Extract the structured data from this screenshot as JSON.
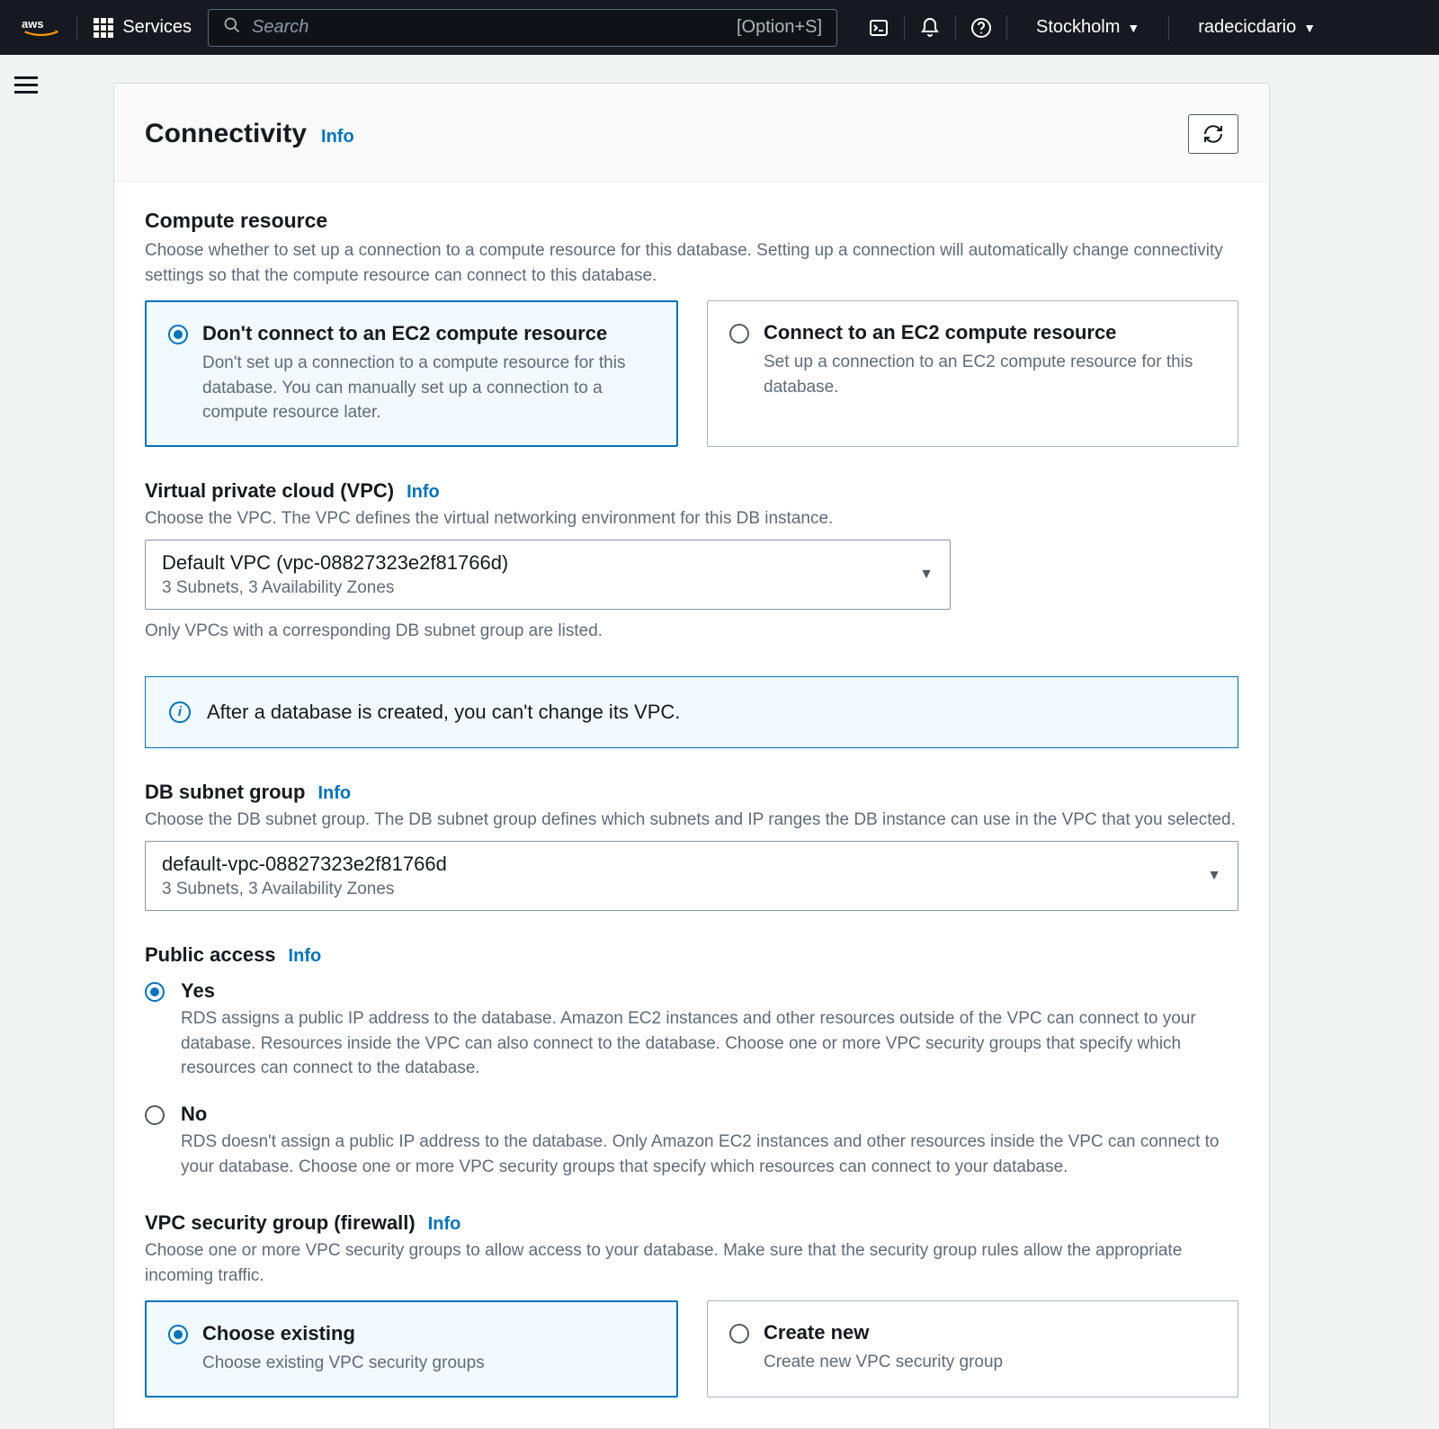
{
  "topbar": {
    "services": "Services",
    "search_placeholder": "Search",
    "kbd_hint": "[Option+S]",
    "region": "Stockholm",
    "user": "radecicdario"
  },
  "panel": {
    "title": "Connectivity",
    "info": "Info"
  },
  "compute": {
    "title": "Compute resource",
    "desc": "Choose whether to set up a connection to a compute resource for this database. Setting up a connection will automatically change connectivity settings so that the compute resource can connect to this database.",
    "opt_a_title": "Don't connect to an EC2 compute resource",
    "opt_a_desc": "Don't set up a connection to a compute resource for this database. You can manually set up a connection to a compute resource later.",
    "opt_b_title": "Connect to an EC2 compute resource",
    "opt_b_desc": "Set up a connection to an EC2 compute resource for this database."
  },
  "vpc": {
    "label": "Virtual private cloud (VPC)",
    "info": "Info",
    "desc": "Choose the VPC. The VPC defines the virtual networking environment for this DB instance.",
    "value": "Default VPC (vpc-08827323e2f81766d)",
    "sub": "3 Subnets, 3 Availability Zones",
    "helper": "Only VPCs with a corresponding DB subnet group are listed.",
    "banner": "After a database is created, you can't change its VPC."
  },
  "subnet": {
    "label": "DB subnet group",
    "info": "Info",
    "desc": "Choose the DB subnet group. The DB subnet group defines which subnets and IP ranges the DB instance can use in the VPC that you selected.",
    "value": "default-vpc-08827323e2f81766d",
    "sub": "3 Subnets, 3 Availability Zones"
  },
  "public": {
    "label": "Public access",
    "info": "Info",
    "yes_label": "Yes",
    "yes_desc": "RDS assigns a public IP address to the database. Amazon EC2 instances and other resources outside of the VPC can connect to your database. Resources inside the VPC can also connect to the database. Choose one or more VPC security groups that specify which resources can connect to the database.",
    "no_label": "No",
    "no_desc": "RDS doesn't assign a public IP address to the database. Only Amazon EC2 instances and other resources inside the VPC can connect to your database. Choose one or more VPC security groups that specify which resources can connect to your database."
  },
  "sg": {
    "label": "VPC security group (firewall)",
    "info": "Info",
    "desc": "Choose one or more VPC security groups to allow access to your database. Make sure that the security group rules allow the appropriate incoming traffic.",
    "opt_a_title": "Choose existing",
    "opt_a_desc": "Choose existing VPC security groups",
    "opt_b_title": "Create new",
    "opt_b_desc": "Create new VPC security group"
  }
}
